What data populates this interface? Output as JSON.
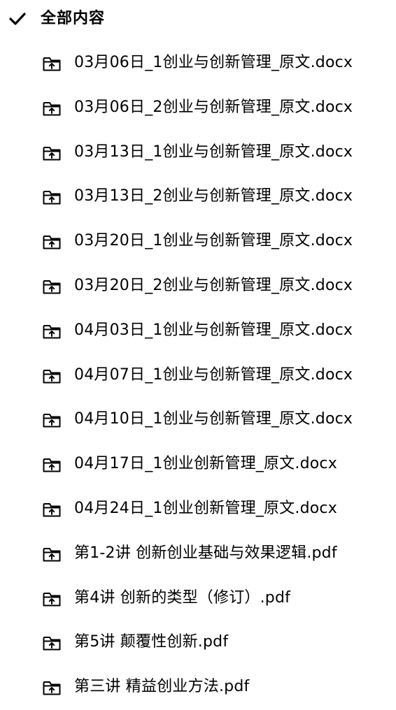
{
  "header": {
    "title": "全部内容",
    "icon": "check-icon"
  },
  "files": [
    {
      "name": "03月06日_1创业与创新管理_原文.docx",
      "icon": "folder-upload-icon"
    },
    {
      "name": "03月06日_2创业与创新管理_原文.docx",
      "icon": "folder-upload-icon"
    },
    {
      "name": "03月13日_1创业与创新管理_原文.docx",
      "icon": "folder-upload-icon"
    },
    {
      "name": "03月13日_2创业与创新管理_原文.docx",
      "icon": "folder-upload-icon"
    },
    {
      "name": "03月20日_1创业与创新管理_原文.docx",
      "icon": "folder-upload-icon"
    },
    {
      "name": "03月20日_2创业与创新管理_原文.docx",
      "icon": "folder-upload-icon"
    },
    {
      "name": "04月03日_1创业与创新管理_原文.docx",
      "icon": "folder-upload-icon"
    },
    {
      "name": "04月07日_1创业与创新管理_原文.docx",
      "icon": "folder-upload-icon"
    },
    {
      "name": "04月10日_1创业与创新管理_原文.docx",
      "icon": "folder-upload-icon"
    },
    {
      "name": "04月17日_1创业创新管理_原文.docx",
      "icon": "folder-upload-icon"
    },
    {
      "name": "04月24日_1创业创新管理_原文.docx",
      "icon": "folder-upload-icon"
    },
    {
      "name": "第1-2讲 创新创业基础与效果逻辑.pdf",
      "icon": "folder-upload-icon"
    },
    {
      "name": "第4讲 创新的类型（修订）.pdf",
      "icon": "folder-upload-icon"
    },
    {
      "name": "第5讲 颠覆性创新.pdf",
      "icon": "folder-upload-icon"
    },
    {
      "name": "第三讲 精益创业方法.pdf",
      "icon": "folder-upload-icon"
    }
  ]
}
